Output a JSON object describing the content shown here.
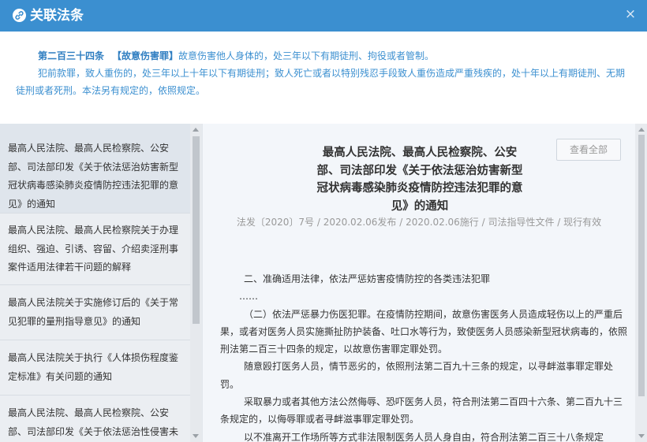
{
  "header": {
    "title": "关联法条",
    "logo_icon": "link-icon",
    "close_label": "×"
  },
  "article": {
    "number": "第二百三十四条",
    "crime": "【故意伤害罪】",
    "para1_rest": "故意伤害他人身体的，处三年以下有期徒刑、拘役或者管制。",
    "para2": "犯前款罪，致人重伤的，处三年以上十年以下有期徒刑；致人死亡或者以特别残忍手段致人重伤造成严重残疾的，处十年以上有期徒刑、无期徒刑或者死刑。本法另有规定的，依照规定。"
  },
  "list": {
    "items": [
      {
        "l1": "最高人民法院、最高人民检察院、公安",
        "l2": "部、司法部印发《关于依法惩治妨害新型",
        "l3": "冠状病毒感染肺炎疫情防控违法犯罪的意",
        "l4": "见》的通知"
      },
      {
        "l1": "最高人民法院、最高人民检察院关于办理",
        "l2": "组织、强迫、引诱、容留、介绍卖淫刑事",
        "l3": "案件适用法律若干问题的解释"
      },
      {
        "l1": "最高人民法院关于实施修订后的《关于常",
        "l2": "见犯罪的量刑指导意见》的通知"
      },
      {
        "l1": "最高人民法院关于执行《人体损伤程度鉴",
        "l2": "定标准》有关问题的通知"
      },
      {
        "l1": "最高人民法院、最高人民检察院、公安",
        "l2": "部、司法部印发《关于依法惩治性侵害未"
      }
    ]
  },
  "detail": {
    "title_l1": "最高人民法院、最高人民检察院、公安",
    "title_l2": "部、司法部印发《关于依法惩治妨害新型",
    "title_l3": "冠状病毒感染肺炎疫情防控违法犯罪的意",
    "title_l4": "见》的通知",
    "view_all": "查看全部",
    "meta": "法发〔2020〕7号 / 2020.02.06发布 / 2020.02.06施行 / 司法指导性文件 / 现行有效",
    "section": "二、准确适用法律，依法严惩妨害疫情防控的各类违法犯罪",
    "ellipsis": "……",
    "p1": "（二）依法严惩暴力伤医犯罪。在疫情防控期间，故意伤害医务人员造成轻伤以上的严重后果，或者对医务人员实施撕扯防护装备、吐口水等行为，致使医务人员感染新型冠状病毒的，依照刑法第二百三十四条的规定，以故意伤害罪定罪处罚。",
    "p2": "随意殴打医务人员，情节恶劣的，依照刑法第二百九十三条的规定，以寻衅滋事罪定罪处罚。",
    "p3": "采取暴力或者其他方法公然侮辱、恐吓医务人员，符合刑法第二百四十六条、第二百九十三条规定的，以侮辱罪或者寻衅滋事罪定罪处罚。",
    "p4": "以不准离开工作场所等方式非法限制医务人员人身自由，符合刑法第二百三十八条规定"
  },
  "colors": {
    "header_bg": "#3b8fd0",
    "article_text": "#3b8fd0",
    "list_bg": "#ebeef2",
    "detail_bg": "#f3f6fa"
  }
}
